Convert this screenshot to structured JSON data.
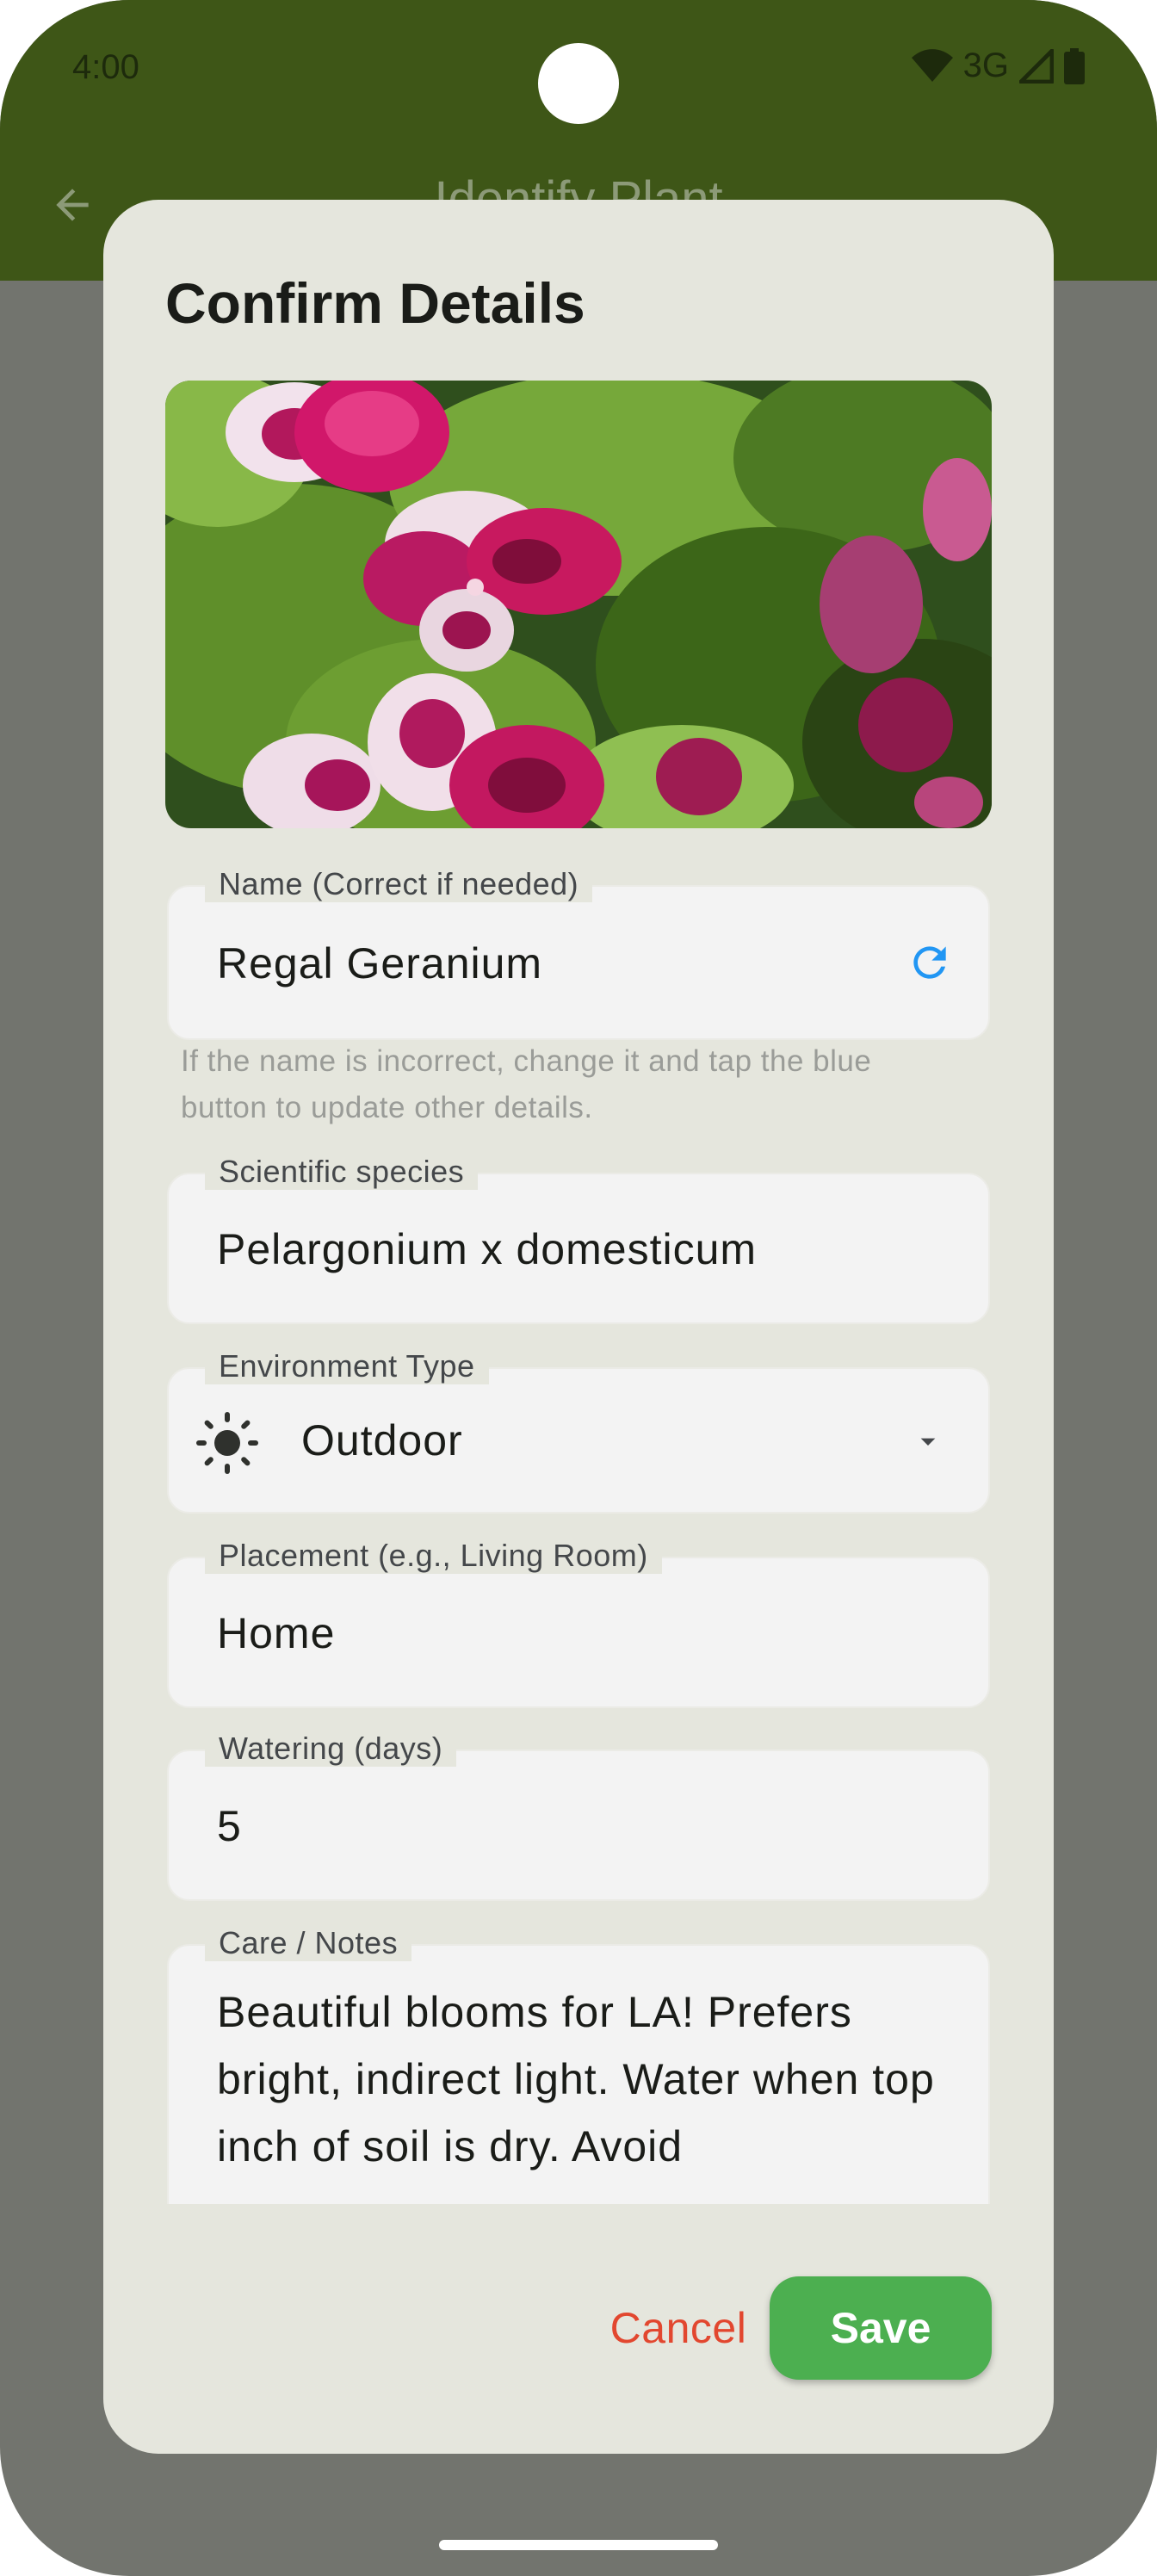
{
  "status_bar": {
    "time": "4:00",
    "network": "3G",
    "icons": [
      "wifi-icon",
      "signal-icon",
      "battery-icon"
    ]
  },
  "app_bar": {
    "title": "Identify Plant",
    "back_icon": "arrow-back-icon"
  },
  "dialog": {
    "title": "Confirm Details",
    "photo": "plant-photo",
    "fields": {
      "name": {
        "label": "Name (Correct if needed)",
        "value": "Regal Geranium",
        "action_icon": "refresh-icon",
        "helper": "If the name is incorrect, change it and tap the blue button to update other details."
      },
      "species": {
        "label": "Scientific species",
        "value": "Pelargonium x domesticum"
      },
      "environment": {
        "label": "Environment Type",
        "value": "Outdoor",
        "icon": "sun-icon"
      },
      "placement": {
        "label": "Placement (e.g., Living Room)",
        "value": "Home"
      },
      "watering": {
        "label": "Watering (days)",
        "value": "5"
      },
      "notes": {
        "label": "Care / Notes",
        "value": "Beautiful blooms for LA! Prefers bright, indirect light. Water when top inch of soil is dry. Avoid"
      }
    },
    "actions": {
      "cancel": "Cancel",
      "save": "Save"
    }
  },
  "colors": {
    "app_bar": "#3e5617",
    "scrim": "#72746e",
    "dialog_bg": "#e5e6dd",
    "accent_blue": "#2196f3",
    "cancel_red": "#e2472f",
    "save_green": "#4caf50"
  }
}
